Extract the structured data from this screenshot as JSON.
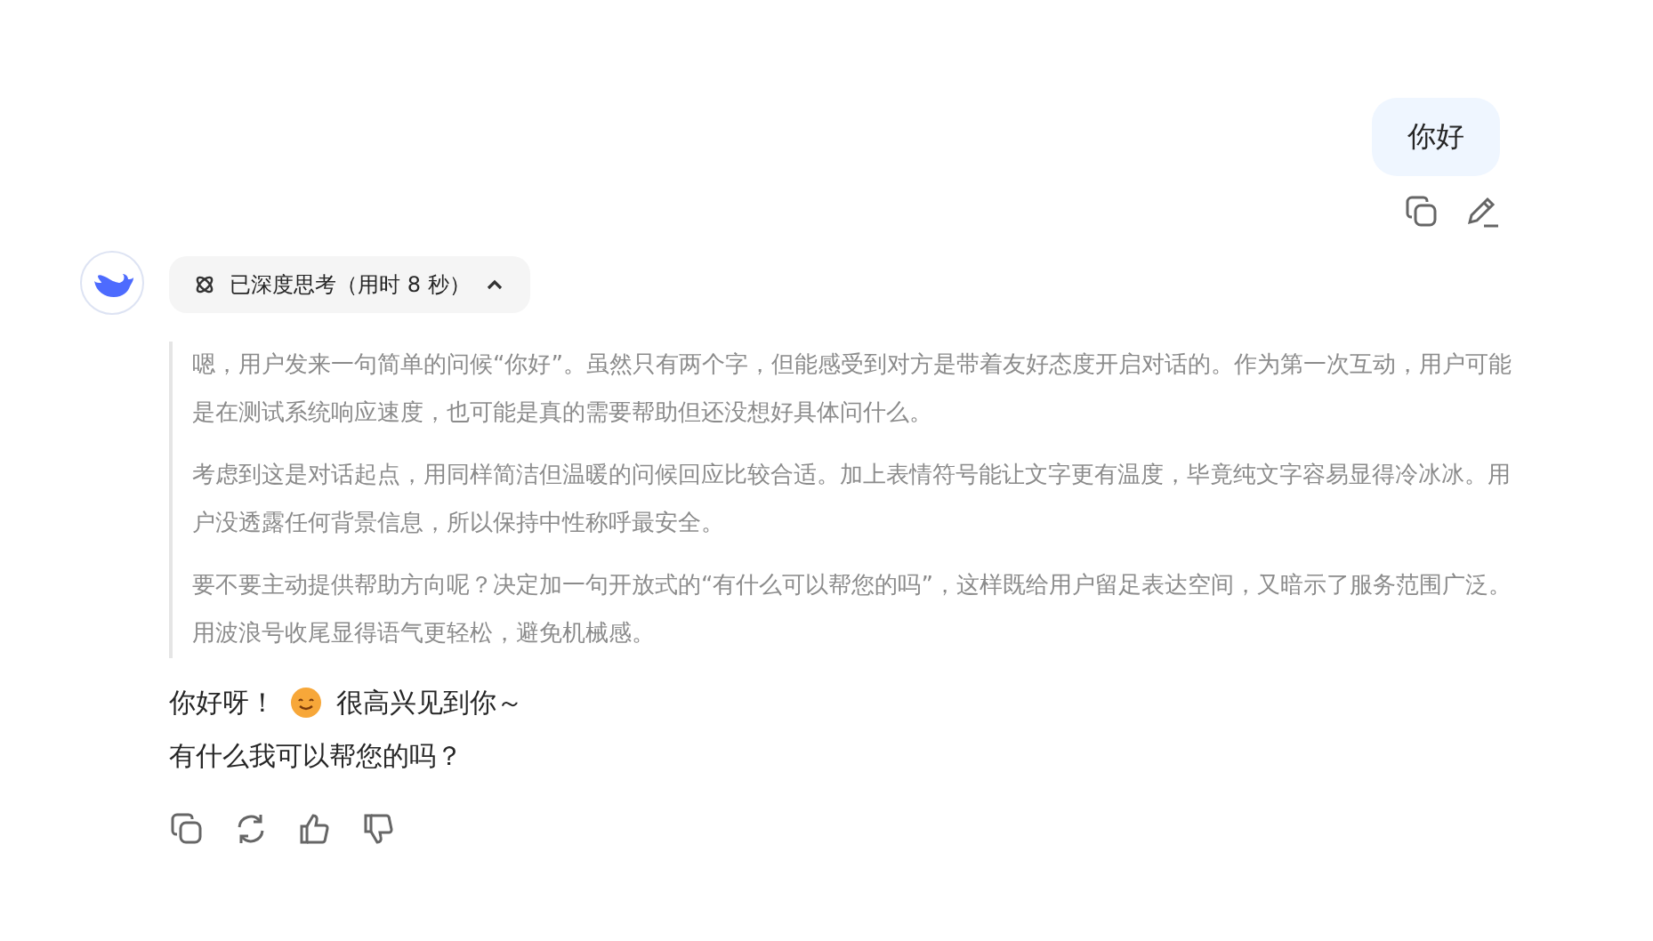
{
  "user_message": {
    "text": "你好"
  },
  "thinking": {
    "label": "已深度思考（用时 8 秒）",
    "expanded": true,
    "paragraphs": [
      "嗯，用户发来一句简单的问候“你好”。虽然只有两个字，但能感受到对方是带着友好态度开启对话的。作为第一次互动，用户可能是在测试系统响应速度，也可能是真的需要帮助但还没想好具体问什么。",
      "考虑到这是对话起点，用同样简洁但温暖的问候回应比较合适。加上表情符号能让文字更有温度，毕竟纯文字容易显得冷冰冰。用户没透露任何背景信息，所以保持中性称呼最安全。",
      "要不要主动提供帮助方向呢？决定加一句开放式的“有什么可以帮您的吗”，这样既给用户留足表达空间，又暗示了服务范围广泛。用波浪号收尾显得语气更轻松，避免机械感。"
    ]
  },
  "answer": {
    "lines": [
      [
        {
          "kind": "text",
          "text": "你好呀！"
        },
        {
          "kind": "emoji"
        },
        {
          "kind": "text",
          "text": "很高兴见到你～"
        }
      ],
      [
        {
          "kind": "text",
          "text": "有什么我可以帮您的吗？"
        }
      ]
    ]
  }
}
